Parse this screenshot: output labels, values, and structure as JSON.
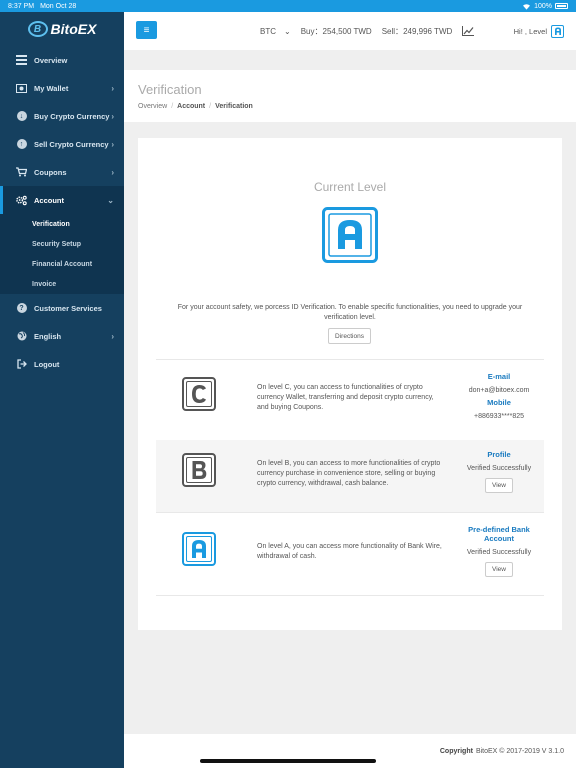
{
  "status_bar": {
    "time": "8:37 PM",
    "date": "Mon Oct 28",
    "battery": "100%"
  },
  "brand": {
    "name": "BitoEX",
    "accent": "#1a9ae0",
    "sidebar_bg": "#15405f"
  },
  "sidebar": {
    "items": [
      {
        "label": "Overview",
        "icon": "overview-icon"
      },
      {
        "label": "My Wallet",
        "icon": "wallet-icon"
      },
      {
        "label": "Buy Crypto Currency",
        "icon": "buy-icon"
      },
      {
        "label": "Sell Crypto Currency",
        "icon": "sell-icon"
      },
      {
        "label": "Coupons",
        "icon": "cart-icon"
      },
      {
        "label": "Account",
        "icon": "gears-icon"
      },
      {
        "label": "Customer Services",
        "icon": "help-icon"
      },
      {
        "label": "English",
        "icon": "globe-icon"
      },
      {
        "label": "Logout",
        "icon": "logout-icon"
      }
    ],
    "account_sub": [
      "Verification",
      "Security Setup",
      "Financial Account",
      "Invoice"
    ]
  },
  "topbar": {
    "coin": "BTC",
    "buy_label": "Buy：",
    "buy_value": "254,500 TWD",
    "sell_label": "Sell：",
    "sell_value": "249,996 TWD",
    "greeting": "Hi!  , Level"
  },
  "page": {
    "title": "Verification",
    "breadcrumb": [
      "Overview",
      "Account",
      "Verification"
    ]
  },
  "card": {
    "current_level_label": "Current Level",
    "current_level": "A",
    "notice": "For your account safety, we porcess ID Verification. To enable specific functionalities, you need to upgrade your verification level.",
    "directions_button": "Directions",
    "levels": [
      {
        "letter": "C",
        "desc": "On level C, you can access to functionalities of crypto currency Wallet, transferring and deposit crypto currency, and buying Coupons.",
        "heading1": "E-mail",
        "value1": "don+a@bitoex.com",
        "heading2": "Mobile",
        "value2": "+886933****825"
      },
      {
        "letter": "B",
        "desc": "On level B, you can access to more functionalities of crypto currency purchase in convenience store, selling or buying crypto currency, withdrawal, cash balance.",
        "heading1": "Profile",
        "status": "Verified Successfully",
        "button": "View"
      },
      {
        "letter": "A",
        "desc": "On level A, you can access more functionality of Bank Wire, withdrawal of cash.",
        "heading1": "Pre-defined Bank Account",
        "status": "Verified Successfully",
        "button": "View"
      }
    ]
  },
  "footer": {
    "copyright_label": "Copyright",
    "copyright_text": "BitoEX © 2017-2019 V 3.1.0"
  }
}
